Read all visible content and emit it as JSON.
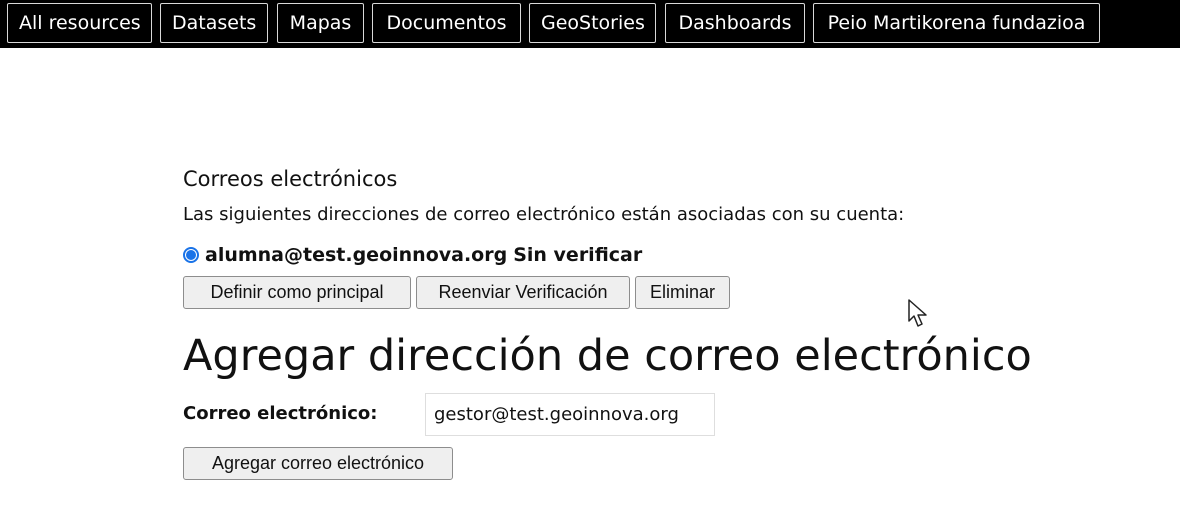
{
  "nav": {
    "items": [
      {
        "label": "All resources"
      },
      {
        "label": "Datasets"
      },
      {
        "label": "Mapas"
      },
      {
        "label": "Documentos"
      },
      {
        "label": "GeoStories"
      },
      {
        "label": "Dashboards"
      },
      {
        "label": "Peio Martikorena fundazioa"
      }
    ]
  },
  "emails": {
    "title": "Correos electrónicos",
    "description": "Las siguientes direcciones de correo electrónico están asociadas con su cuenta:",
    "list": [
      {
        "address": "alumna@test.geoinnova.org",
        "status": "Sin verificar"
      }
    ],
    "buttons": {
      "primary": "Definir como principal",
      "resend": "Reenviar Verificación",
      "delete": "Eliminar"
    }
  },
  "add_email": {
    "title": "Agregar dirección de correo electrónico",
    "label": "Correo electrónico:",
    "value": "gestor@test.geoinnova.org",
    "button": "Agregar correo electrónico"
  },
  "colors": {
    "topbar": "#000000",
    "radio": "#1a73e8"
  },
  "icons": {
    "cursor": "mouse-pointer-icon"
  }
}
